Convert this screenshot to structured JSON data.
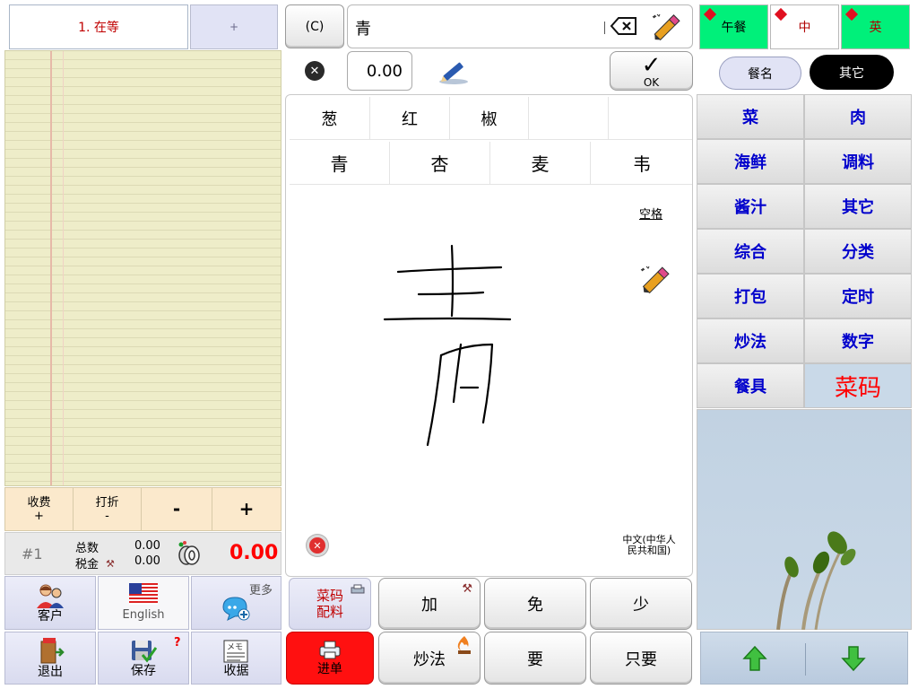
{
  "order_tabs": {
    "active": "1. 在等",
    "add": "+"
  },
  "action_row": {
    "charge_label": "收费",
    "charge_sign": "+",
    "discount_label": "打折",
    "discount_sign": "-",
    "minus": "-",
    "plus": "+"
  },
  "totals": {
    "order_number": "#1",
    "subtotal_label": "总数",
    "subtotal_value": "0.00",
    "tax_label": "税金",
    "tax_value": "0.00",
    "grand_total": "0.00"
  },
  "left_buttons": {
    "customer": "客户",
    "language": "English",
    "more": "更多",
    "exit": "退出",
    "save": "保存",
    "save_badge": "?",
    "receipt": "收据",
    "memo_tag": "メモ"
  },
  "input": {
    "clear_label": "(C)",
    "text": "青",
    "quantity": "0.00",
    "ok_label": "OK"
  },
  "handwriting": {
    "row1": [
      "葱",
      "红",
      "椒",
      "",
      ""
    ],
    "row2": [
      "青",
      "杏",
      "麦",
      "韦"
    ],
    "space_label": "空格",
    "language_label": "中文(中华人民共和国)"
  },
  "bottom_mid": {
    "mod_code_line1": "菜码",
    "mod_code_line2": "配料",
    "send_label": "进单",
    "add": "加",
    "free": "免",
    "less": "少",
    "cooking": "炒法",
    "want": "要",
    "only": "只要"
  },
  "meal_tabs": [
    "午餐",
    "中",
    "英"
  ],
  "category_tabs": {
    "name": "餐名",
    "other": "其它"
  },
  "categories": [
    "菜",
    "肉",
    "海鲜",
    "调料",
    "酱汁",
    "其它",
    "综合",
    "分类",
    "打包",
    "定时",
    "炒法",
    "数字",
    "餐具",
    "菜码"
  ],
  "colors": {
    "accent_red": "#ff0000",
    "category_blue": "#0000cc",
    "meal_tab_green": "#00f07a",
    "send_red": "#ff1010"
  }
}
